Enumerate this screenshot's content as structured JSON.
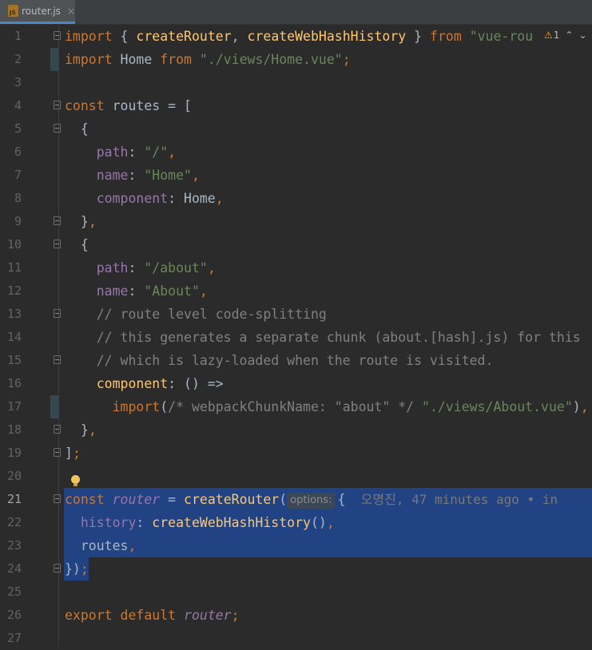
{
  "tab": {
    "filename": "router.js",
    "icon": "js-file-icon",
    "close": "×"
  },
  "inspections": {
    "warning_count": "1",
    "up": "⌃",
    "down": "⌄"
  },
  "lines": [
    {
      "n": "1"
    },
    {
      "n": "2"
    },
    {
      "n": "3"
    },
    {
      "n": "4"
    },
    {
      "n": "5"
    },
    {
      "n": "6"
    },
    {
      "n": "7"
    },
    {
      "n": "8"
    },
    {
      "n": "9"
    },
    {
      "n": "10"
    },
    {
      "n": "11"
    },
    {
      "n": "12"
    },
    {
      "n": "13"
    },
    {
      "n": "14"
    },
    {
      "n": "15"
    },
    {
      "n": "16"
    },
    {
      "n": "17"
    },
    {
      "n": "18"
    },
    {
      "n": "19"
    },
    {
      "n": "20"
    },
    {
      "n": "21"
    },
    {
      "n": "22"
    },
    {
      "n": "23"
    },
    {
      "n": "24"
    },
    {
      "n": "25"
    },
    {
      "n": "26"
    },
    {
      "n": "27"
    }
  ],
  "code": {
    "l1": {
      "kw": "import",
      "a": " { ",
      "fn1": "createRouter",
      "b": ", ",
      "fn2": "createWebHashHistory",
      "c": " } ",
      "from": "from",
      "str": " \"vue-rou"
    },
    "l2": {
      "kw": "import",
      "a": " Home ",
      "from": "from",
      "str": " \"./views/Home.vue\"",
      "semi": ";"
    },
    "l4": {
      "kw": "const",
      "a": " routes = ["
    },
    "l5": {
      "a": "  {"
    },
    "l6": {
      "prop": "    path",
      "a": ": ",
      "str": "\"/\"",
      "b": ","
    },
    "l7": {
      "prop": "    name",
      "a": ": ",
      "str": "\"Home\"",
      "b": ","
    },
    "l8": {
      "prop": "    component",
      "a": ": Home",
      "b": ","
    },
    "l9": {
      "a": "  }",
      "b": ","
    },
    "l10": {
      "a": "  {"
    },
    "l11": {
      "prop": "    path",
      "a": ": ",
      "str": "\"/about\"",
      "b": ","
    },
    "l12": {
      "prop": "    name",
      "a": ": ",
      "str": "\"About\"",
      "b": ","
    },
    "l13": {
      "cm": "    // route level code-splitting"
    },
    "l14": {
      "cm": "    // this generates a separate chunk (about.[hash].js) for this"
    },
    "l15": {
      "cm": "    // which is lazy-loaded when the route is visited."
    },
    "l16": {
      "fn": "    component",
      "a": ": () =>"
    },
    "l17": {
      "kw": "      import",
      "a": "(",
      "cm": "/* webpackChunkName: \"about\" */",
      "sp": " ",
      "str": "\"./views/About.vue\"",
      "b": ")",
      "c": ","
    },
    "l18": {
      "a": "  }",
      "b": ","
    },
    "l19": {
      "a": "]",
      "b": ";"
    },
    "l21": {
      "kw": "const",
      "sp": " ",
      "var": "router",
      "a": " = ",
      "fn": "createRouter",
      "b": "(",
      "hint": "options:",
      "c": "{",
      "blame": "  오명진, 47 minutes ago • in"
    },
    "l22": {
      "prop": "  history",
      "a": ": ",
      "fn": "createWebHashHistory",
      "b": "()",
      "c": ","
    },
    "l23": {
      "a": "  routes",
      "b": ","
    },
    "l24": {
      "a": "})",
      "b": ";"
    },
    "l26": {
      "kw": "export default",
      "sp": " ",
      "var": "router",
      "b": ";"
    }
  },
  "colors": {
    "background": "#2b2b2b",
    "selection": "#214283",
    "keyword": "#cc7832",
    "string": "#6a8759",
    "property": "#9876aa",
    "function": "#ffc66d",
    "comment": "#808080"
  }
}
